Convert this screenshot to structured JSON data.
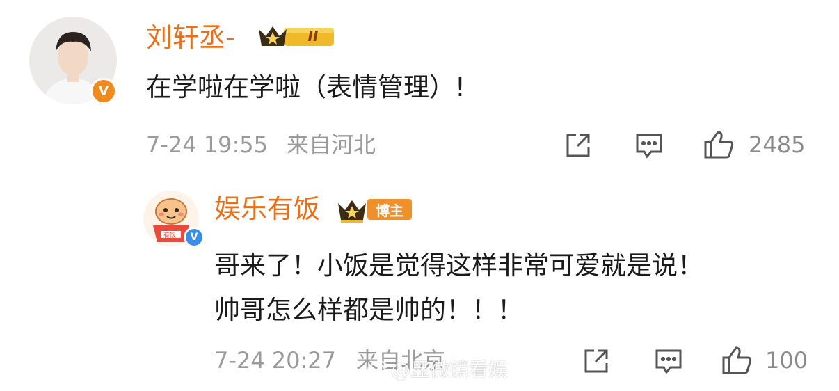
{
  "comment": {
    "user_name": "刘轩丞-",
    "level_badge": "II",
    "text": "在学啦在学啦（表情管理）!",
    "time": "7-24 19:55",
    "location": "来自河北",
    "like_count": "2485",
    "icons": [
      "share-icon",
      "comment-icon",
      "like-icon"
    ]
  },
  "reply": {
    "user_name": "娱乐有饭",
    "role_badge": "博主",
    "avatar_label": "有饭",
    "text_line1": "哥来了！小饭是觉得这样非常可爱就是说！",
    "text_line2": "帅哥怎么样都是帅的！！！",
    "time": "7-24 20:27",
    "location": "来自北京",
    "like_count": "100",
    "icons": [
      "share-icon",
      "comment-icon",
      "like-icon"
    ]
  },
  "watermark": {
    "text": "@显微镜看娱"
  },
  "colors": {
    "name": "#e8701a",
    "meta": "#9a9a9a",
    "verified_orange": "#f08a1c",
    "verified_blue": "#3a8ee6",
    "badge_gold": "#f0b92a"
  }
}
